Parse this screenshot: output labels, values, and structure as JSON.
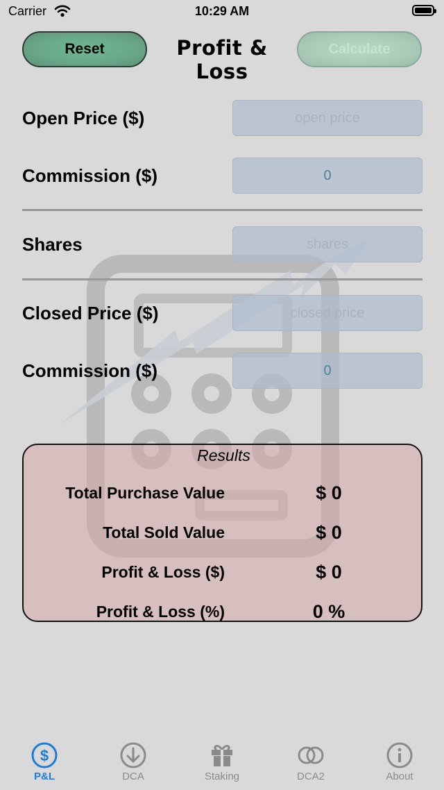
{
  "status_bar": {
    "carrier": "Carrier",
    "time": "10:29 AM"
  },
  "header": {
    "reset_label": "Reset",
    "title": "Profit & Loss",
    "calculate_label": "Calculate"
  },
  "form": {
    "open_price_label": "Open Price ($)",
    "open_price_placeholder": "open price",
    "open_commission_label": "Commission ($)",
    "open_commission_value": "0",
    "shares_label": "Shares",
    "shares_placeholder": "shares",
    "closed_price_label": "Closed Price ($)",
    "closed_price_placeholder": "closed price",
    "closed_commission_label": "Commission ($)",
    "closed_commission_value": "0"
  },
  "results": {
    "title": "Results",
    "rows": [
      {
        "label": "Total Purchase Value",
        "value": "$ 0"
      },
      {
        "label": "Total Sold Value",
        "value": "$ 0"
      },
      {
        "label": "Profit & Loss ($)",
        "value": "$ 0"
      },
      {
        "label": "Profit & Loss (%)",
        "value": "0 %"
      }
    ]
  },
  "tabs": [
    {
      "label": "P&L",
      "icon": "dollar-circle-icon",
      "active": true
    },
    {
      "label": "DCA",
      "icon": "arrow-down-circle-icon",
      "active": false
    },
    {
      "label": "Staking",
      "icon": "gift-icon",
      "active": false
    },
    {
      "label": "DCA2",
      "icon": "two-circles-icon",
      "active": false
    },
    {
      "label": "About",
      "icon": "info-circle-icon",
      "active": false
    }
  ],
  "colors": {
    "accent": "#1e7bd8",
    "reset_button": "#6aa88a",
    "results_bg": "#d7aaaa"
  }
}
